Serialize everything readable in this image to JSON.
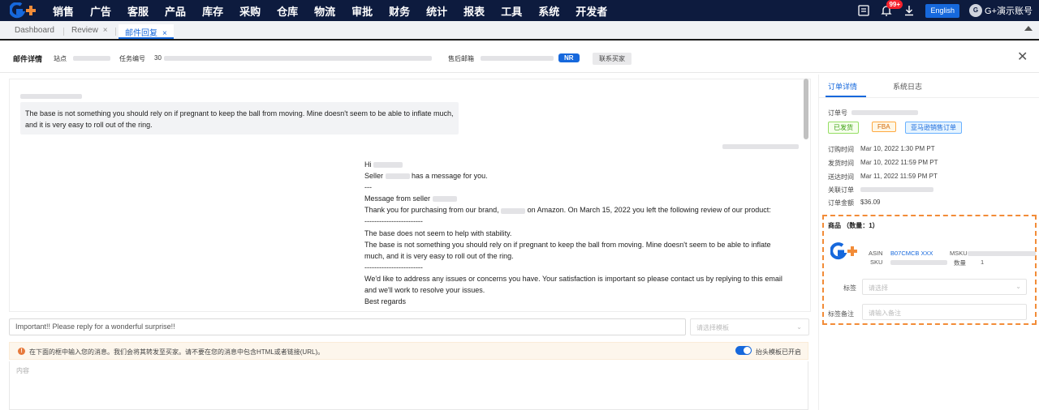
{
  "nav": {
    "items": [
      "销售",
      "广告",
      "客服",
      "产品",
      "库存",
      "采购",
      "仓库",
      "物流",
      "审批",
      "财务",
      "统计",
      "报表",
      "工具",
      "系统",
      "开发者"
    ],
    "badge": "99+",
    "lang": "English",
    "user": "G+演示账号",
    "avatar_initial": "G"
  },
  "tabs": [
    {
      "label": "Dashboard"
    },
    {
      "label": "Review",
      "close": "×"
    },
    {
      "label": "邮件回复",
      "close": "×"
    }
  ],
  "mail_header": {
    "title": "邮件详情",
    "site_label": "站点",
    "task_label": "任务编号",
    "task_prefix": "30",
    "email_label": "售后邮箱",
    "nr_tag": "NR",
    "contact_button": "联系买家"
  },
  "conversation": {
    "incoming": "The base is not something you should rely on if pregnant to keep the ball from moving. Mine doesn't seem to be able to inflate much, and it is very easy to roll out of the ring.",
    "outgoing": {
      "greeting": "Hi",
      "seller_prefix": "Seller",
      "seller_suffix": "has a message for you.",
      "sep1": "---",
      "from_seller": "Message from seller",
      "para1_a": "Thank you for purchasing from our brand,",
      "para1_b": "on Amazon. On March 15, 2022 you left the following review of our product:",
      "dashes1": "------------------------",
      "review_title": "The base does not seem to help with stability.",
      "review_body": "The base is not something you should rely on if pregnant to keep the ball from moving. Mine doesn't seem to be able to inflate much, and it is very easy to roll out of the ring.",
      "dashes2": "------------------------",
      "para2": "We'd like to address any issues or concerns you have. Your satisfaction is important so please contact us by replying to this email and we'll work to resolve your issues.",
      "closing": "Best regards"
    }
  },
  "reply": {
    "input_value": "Important!! Please reply for a wonderful surprise!!",
    "template_placeholder": "请选择模板",
    "warning": "在下面的框中输入您的消息。我们会将其转发至买家。请不要在您的消息中包含HTML或者链接(URL)。",
    "toggle_label": "抬头模板已开启",
    "compose_placeholder": "内容"
  },
  "right_panel": {
    "tab_order": "订单详情",
    "tab_log": "系统日志",
    "order_no_label": "订单号",
    "tags": [
      "已发货",
      "FBA",
      "亚马逊销售订单"
    ],
    "rows": [
      {
        "label": "订购时间",
        "value": "Mar 10, 2022 1:30 PM PT"
      },
      {
        "label": "发货时间",
        "value": "Mar 10, 2022 11:59 PM PT"
      },
      {
        "label": "送达时间",
        "value": "Mar 11, 2022 11:59 PM PT"
      },
      {
        "label": "关联订单",
        "value": ""
      },
      {
        "label": "订单金额",
        "value": "$36.09"
      }
    ],
    "products": {
      "heading": "商品 （数量：1）",
      "asin_label": "ASIN",
      "asin_value": "B07CMCB XXX",
      "msku_label": "MSKU",
      "sku_label": "SKU",
      "qty_label": "数量",
      "qty_value": "1",
      "tag_label": "标签",
      "tag_placeholder": "请选择",
      "note_label": "标签备注",
      "note_placeholder": "请输入备注"
    }
  },
  "colors": {
    "nav_bg": "#0d1b3e",
    "accent": "#1668dc",
    "highlight_dash": "#f28c38"
  }
}
